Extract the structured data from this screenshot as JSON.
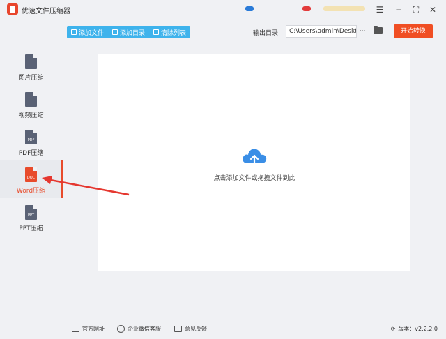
{
  "window": {
    "title": "优速文件压缩器",
    "controls": [
      "menu-icon",
      "minimize-icon",
      "maximize-icon",
      "close-icon"
    ]
  },
  "toolbar": {
    "add_file": "添加文件",
    "add_folder": "添加目录",
    "clear_list": "清除列表",
    "output_label": "输出目录:",
    "output_path": "C:\\Users\\admin\\Deskto",
    "more": "···",
    "start": "开始转换",
    "accent_color": "#3eb3ec",
    "start_color": "#f04e23"
  },
  "sidebar": {
    "items": [
      {
        "label": "图片压缩",
        "icon": "image-file-icon",
        "tag": ""
      },
      {
        "label": "视频压缩",
        "icon": "video-file-icon",
        "tag": ""
      },
      {
        "label": "PDF压缩",
        "icon": "pdf-file-icon",
        "tag": "PDF"
      },
      {
        "label": "Word压缩",
        "icon": "doc-file-icon",
        "tag": "DOC",
        "active": true
      },
      {
        "label": "PPT压缩",
        "icon": "ppt-file-icon",
        "tag": "PPT"
      }
    ],
    "active_color": "#e84b2b"
  },
  "main": {
    "drop_hint": "点击添加文件或拖拽文件到此"
  },
  "footer": {
    "website": "官方网址",
    "wechat": "企业微信客服",
    "feedback": "意见反馈",
    "version": "版本：v2.2.2.0"
  }
}
